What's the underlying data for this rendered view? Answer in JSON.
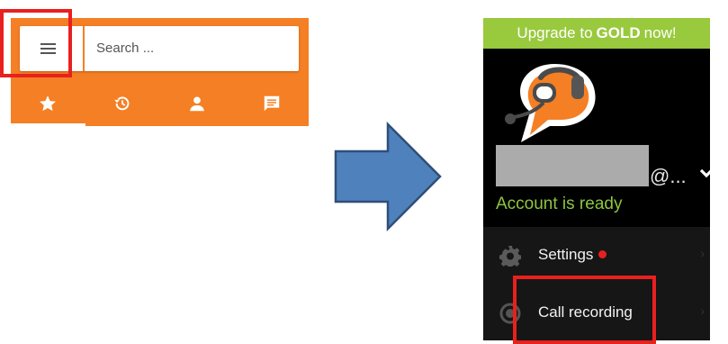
{
  "left": {
    "search_placeholder": "Search ...",
    "tabs": [
      {
        "icon": "star-icon",
        "active": true
      },
      {
        "icon": "history-icon",
        "active": false
      },
      {
        "icon": "person-icon",
        "active": false
      },
      {
        "icon": "message-icon",
        "active": false
      }
    ]
  },
  "right": {
    "upgrade_prefix": "Upgrade to",
    "upgrade_bold": "GOLD",
    "upgrade_suffix": "now!",
    "email_suffix": "@...",
    "account_status": "Account is ready",
    "menu": [
      {
        "label": "Settings",
        "icon": "gear-icon",
        "badge": true
      },
      {
        "label": "Call recording",
        "icon": "record-icon",
        "badge": false
      }
    ]
  },
  "colors": {
    "brand_orange": "#f47f24",
    "upgrade_green": "#99c93d",
    "status_green": "#8dc63f",
    "highlight_red": "#e8201e",
    "arrow_blue": "#4f81bd"
  }
}
